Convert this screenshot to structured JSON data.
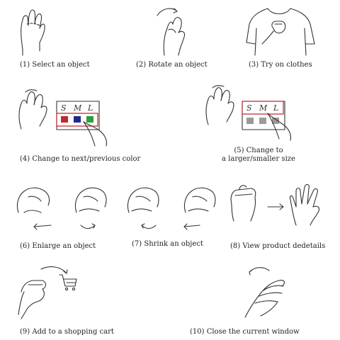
{
  "panels": [
    {
      "id": 1,
      "caption": "(1) Select an object"
    },
    {
      "id": 2,
      "caption": "(2) Rotate an object"
    },
    {
      "id": 3,
      "caption": "(3) Try on clothes"
    },
    {
      "id": 4,
      "caption": "(4) Change to next/previous color",
      "swatches": [
        {
          "color": "#c0282c"
        },
        {
          "color": "#1f2a8a"
        },
        {
          "color": "#2f9e3a"
        }
      ],
      "size_labels": [
        "S",
        "M",
        "L"
      ]
    },
    {
      "id": 5,
      "caption_line1": "(5) Change to",
      "caption_line2": "a larger/smaller size",
      "size_labels": [
        "S",
        "M",
        "L"
      ]
    },
    {
      "id": 6,
      "caption": "(6) Enlarge an object"
    },
    {
      "id": 7,
      "caption": "(7) Shrink an object"
    },
    {
      "id": 8,
      "caption": "(8) View product dedetails"
    },
    {
      "id": 9,
      "caption": "(9) Add to a shopping cart"
    },
    {
      "id": 10,
      "caption": "(10) Close the current window"
    }
  ]
}
